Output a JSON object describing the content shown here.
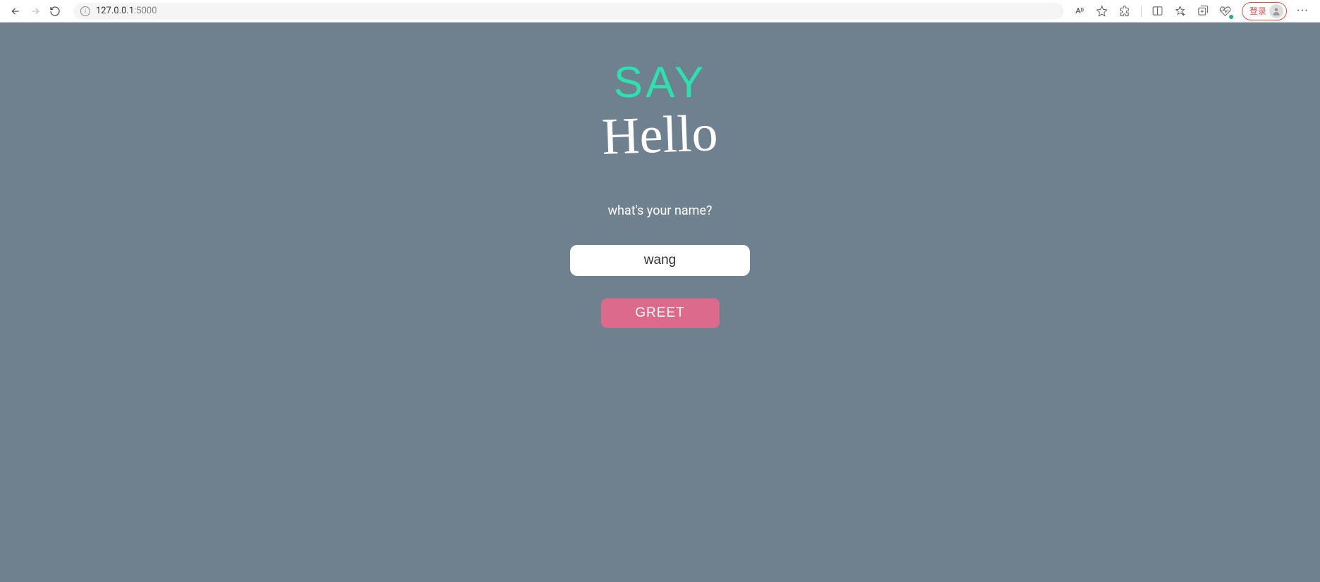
{
  "browser": {
    "url_host": "127.0.0.1",
    "url_port": ":5000",
    "read_aloud": "A⁾⁾",
    "login_label": "登录"
  },
  "page": {
    "logo_top": "SAY",
    "logo_bottom": "Hello",
    "prompt": "what's your name?",
    "name_value": "wang",
    "greet_label": "GREET"
  }
}
